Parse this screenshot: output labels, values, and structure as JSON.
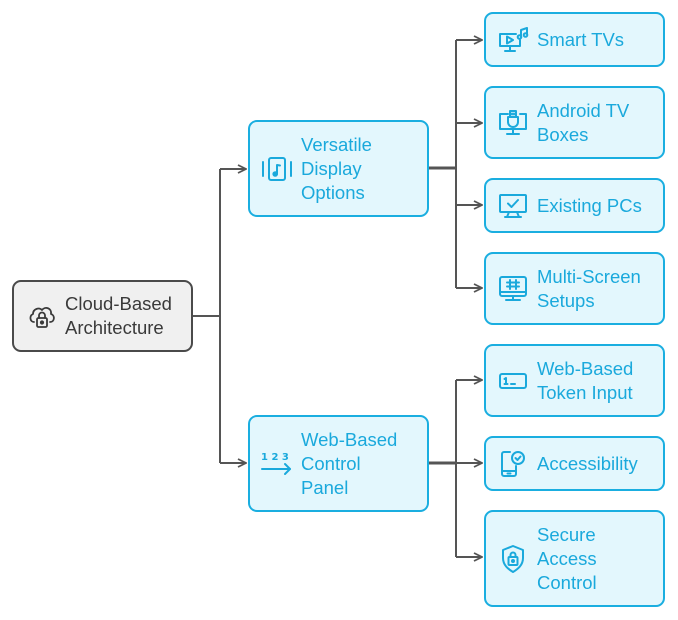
{
  "diagram": {
    "title": "Cloud-Based Architecture",
    "colors": {
      "root_fill": "#f0f0f0",
      "root_stroke": "#4a4a4a",
      "node_fill": "#e3f7fd",
      "node_stroke": "#1aaee0",
      "node_text": "#1aa9dc",
      "connector": "#555555"
    },
    "root": {
      "label": "Cloud-Based\nArchitecture",
      "icon": "cloud-lock-icon"
    },
    "branches": [
      {
        "label": "Versatile\nDisplay\nOptions",
        "icon": "display-music-icon",
        "children": [
          {
            "label": "Smart TVs",
            "icon": "smart-tv-icon"
          },
          {
            "label": "Android TV\nBoxes",
            "icon": "tv-dongle-icon"
          },
          {
            "label": "Existing PCs",
            "icon": "monitor-check-icon"
          },
          {
            "label": "Multi-Screen\nSetups",
            "icon": "monitor-grid-icon"
          }
        ]
      },
      {
        "label": "Web-Based\nControl\nPanel",
        "icon": "numbers-arrow-icon",
        "children": [
          {
            "label": "Web-Based\nToken Input",
            "icon": "token-input-icon"
          },
          {
            "label": "Accessibility",
            "icon": "phone-check-icon"
          },
          {
            "label": "Secure\nAccess\nControl",
            "icon": "shield-lock-icon"
          }
        ]
      }
    ]
  }
}
